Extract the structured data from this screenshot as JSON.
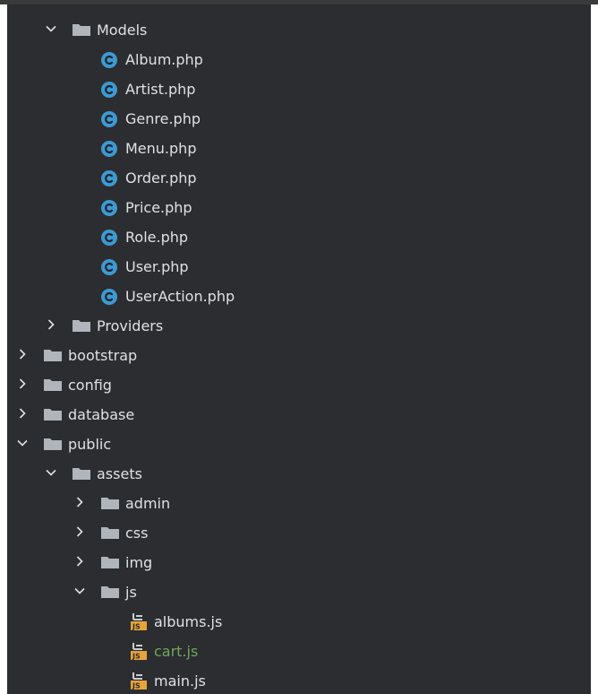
{
  "tree": [
    {
      "label": "Models",
      "type": "folder",
      "depth": 1,
      "expanded": true
    },
    {
      "label": "Album.php",
      "type": "class",
      "depth": 2
    },
    {
      "label": "Artist.php",
      "type": "class",
      "depth": 2
    },
    {
      "label": "Genre.php",
      "type": "class",
      "depth": 2
    },
    {
      "label": "Menu.php",
      "type": "class",
      "depth": 2
    },
    {
      "label": "Order.php",
      "type": "class",
      "depth": 2
    },
    {
      "label": "Price.php",
      "type": "class",
      "depth": 2
    },
    {
      "label": "Role.php",
      "type": "class",
      "depth": 2
    },
    {
      "label": "User.php",
      "type": "class",
      "depth": 2
    },
    {
      "label": "UserAction.php",
      "type": "class",
      "depth": 2
    },
    {
      "label": "Providers",
      "type": "folder",
      "depth": 1,
      "expanded": false
    },
    {
      "label": "bootstrap",
      "type": "folder",
      "depth": 0,
      "expanded": false
    },
    {
      "label": "config",
      "type": "folder",
      "depth": 0,
      "expanded": false
    },
    {
      "label": "database",
      "type": "folder",
      "depth": 0,
      "expanded": false
    },
    {
      "label": "public",
      "type": "folder",
      "depth": 0,
      "expanded": true
    },
    {
      "label": "assets",
      "type": "folder",
      "depth": 1,
      "expanded": true
    },
    {
      "label": "admin",
      "type": "folder",
      "depth": 2,
      "expanded": false
    },
    {
      "label": "css",
      "type": "folder",
      "depth": 2,
      "expanded": false
    },
    {
      "label": "img",
      "type": "folder",
      "depth": 2,
      "expanded": false
    },
    {
      "label": "js",
      "type": "folder",
      "depth": 2,
      "expanded": true
    },
    {
      "label": "albums.js",
      "type": "js",
      "depth": 3
    },
    {
      "label": "cart.js",
      "type": "js",
      "depth": 3,
      "modified": true
    },
    {
      "label": "main.js",
      "type": "js",
      "depth": 3
    }
  ],
  "colors": {
    "background": "#2b2d30",
    "text": "#dfe1e5",
    "modified_text": "#6fa85a",
    "folder": "#b0b5bb",
    "class_icon": "#3d9ad1",
    "js_icon": "#e8a33b"
  },
  "icons": {
    "folder": "folder-icon",
    "class": "php-class-icon",
    "js": "javascript-file-icon",
    "expanded": "chevron-down-icon",
    "collapsed": "chevron-right-icon"
  }
}
